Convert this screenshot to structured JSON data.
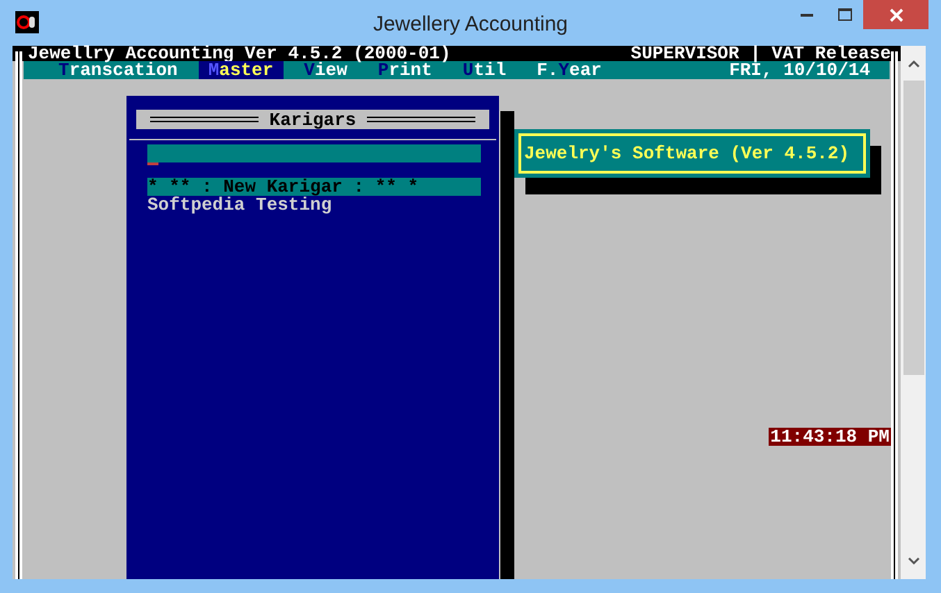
{
  "window": {
    "title": "Jewellery Accounting"
  },
  "console": {
    "header_left": "Jewellry Accounting Ver 4.5.2 (2000-01)",
    "header_right": "SUPERVISOR | VAT Release",
    "menu": [
      {
        "hotkey": "T",
        "suffix": "ranscation",
        "selected": false
      },
      {
        "hotkey": "M",
        "suffix": "aster",
        "selected": true
      },
      {
        "hotkey": "V",
        "suffix": "iew",
        "selected": false
      },
      {
        "hotkey": "P",
        "suffix": "rint",
        "selected": false
      },
      {
        "hotkey": "U",
        "suffix": "til",
        "selected": false
      },
      {
        "prefix": "F.",
        "hotkey": "Y",
        "suffix": "ear",
        "selected": false
      }
    ],
    "date": "FRI, 10/10/14",
    "clock": "11:43:18 PM"
  },
  "karigars": {
    "title": "Karigars",
    "items": [
      {
        "label": "* ** : New Karigar : ** *",
        "selected": true
      },
      {
        "label": "Softpedia Testing",
        "selected": false
      }
    ]
  },
  "splash": {
    "text": "Jewelry's Software (Ver 4.5.2)"
  }
}
